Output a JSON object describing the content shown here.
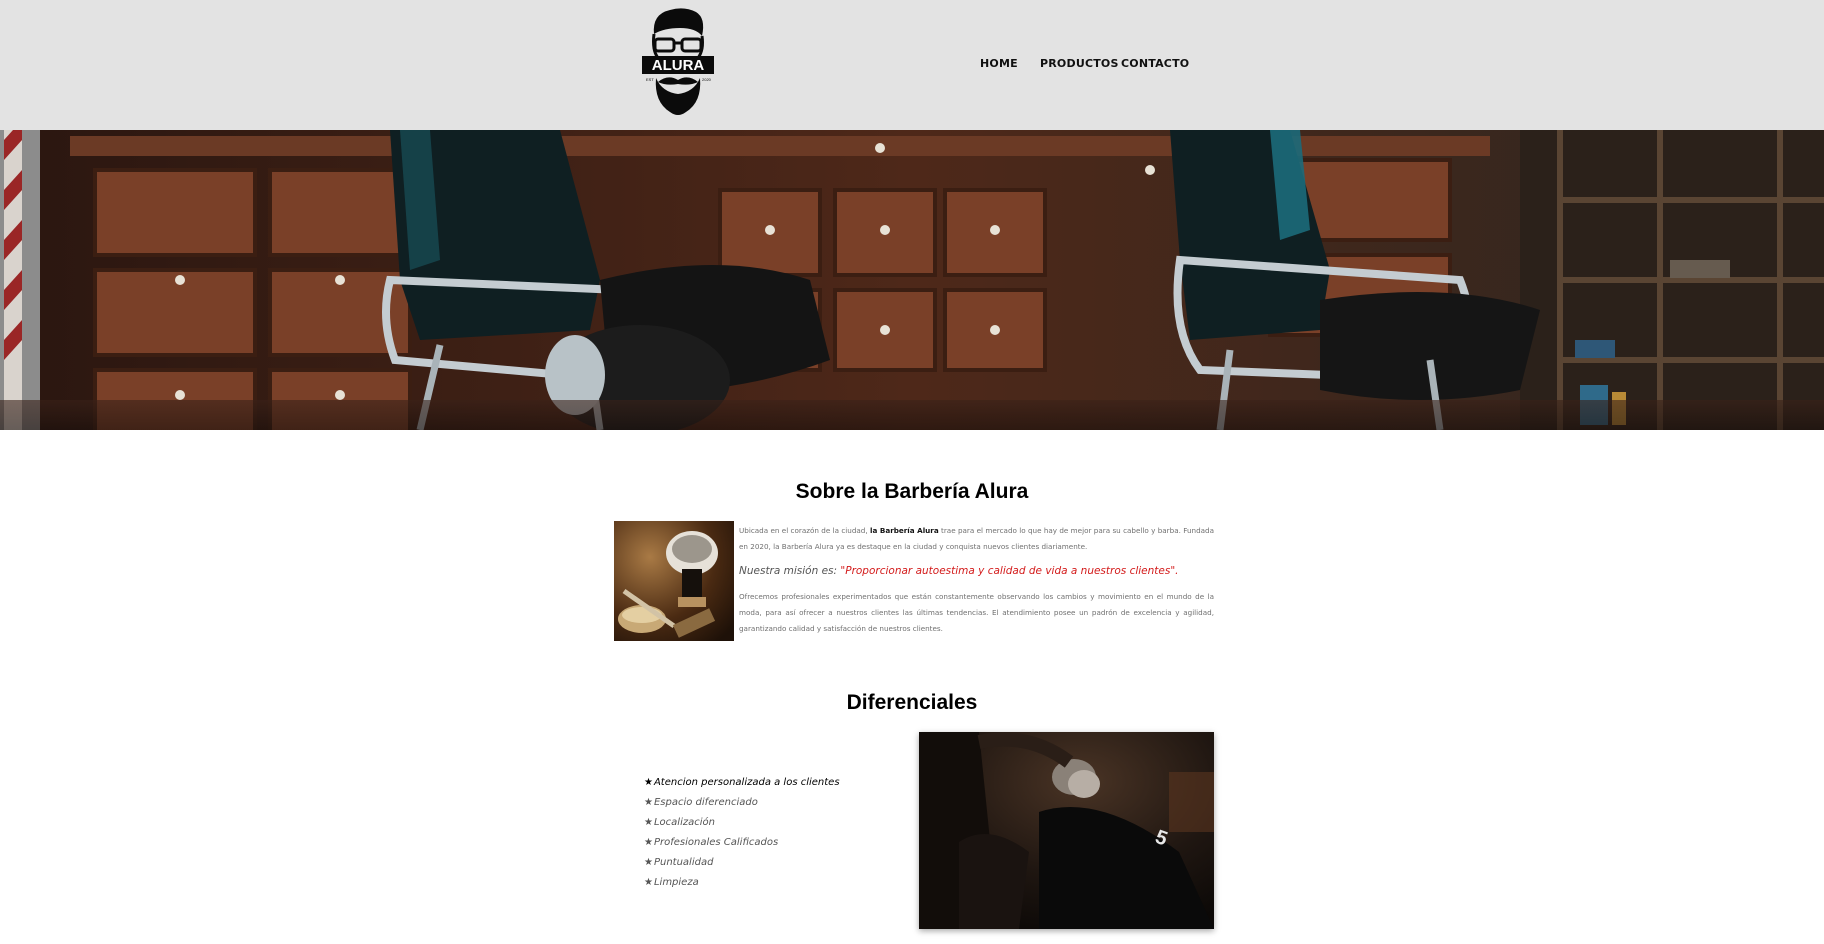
{
  "header": {
    "logo_text": "ALURA",
    "logo_years_left": "EST",
    "logo_years_right": "2020",
    "nav": [
      {
        "label": "HOME"
      },
      {
        "label": "PRODUCTOS"
      },
      {
        "label": "CONTACTO"
      }
    ]
  },
  "about": {
    "title": "Sobre la Barbería Alura",
    "p1_before": "Ubicada en el corazón de la ciudad, ",
    "p1_bold": "la Barbería Alura",
    "p1_after": " trae para el mercado lo que hay de mejor para su cabello y barba. Fundada en 2020, la Barbería Alura ya es destaque en la ciudad y conquista nuevos clientes diariamente.",
    "mission_label": "Nuestra misión es: ",
    "mission_quote": "\"Proporcionar autoestima y calidad de vida a nuestros clientes\".",
    "p2": "Ofrecemos profesionales experimentados que están constantemente observando los cambios y movimiento en el mundo de la moda, para así ofrecer a nuestros clientes las últimas tendencias. El atendimiento posee un padrón de excelencia y agilidad, garantizando calidad y satisfacción de nuestros clientes."
  },
  "differentials": {
    "title": "Diferenciales",
    "star": "★",
    "items": [
      "Atencion personalizada a los clientes",
      "Espacio diferenciado",
      "Localización",
      "Profesionales Calificados",
      "Puntualidad",
      "Limpieza"
    ]
  },
  "colors": {
    "header_bg": "#e3e3e3",
    "mission_quote": "#d31b1b"
  }
}
